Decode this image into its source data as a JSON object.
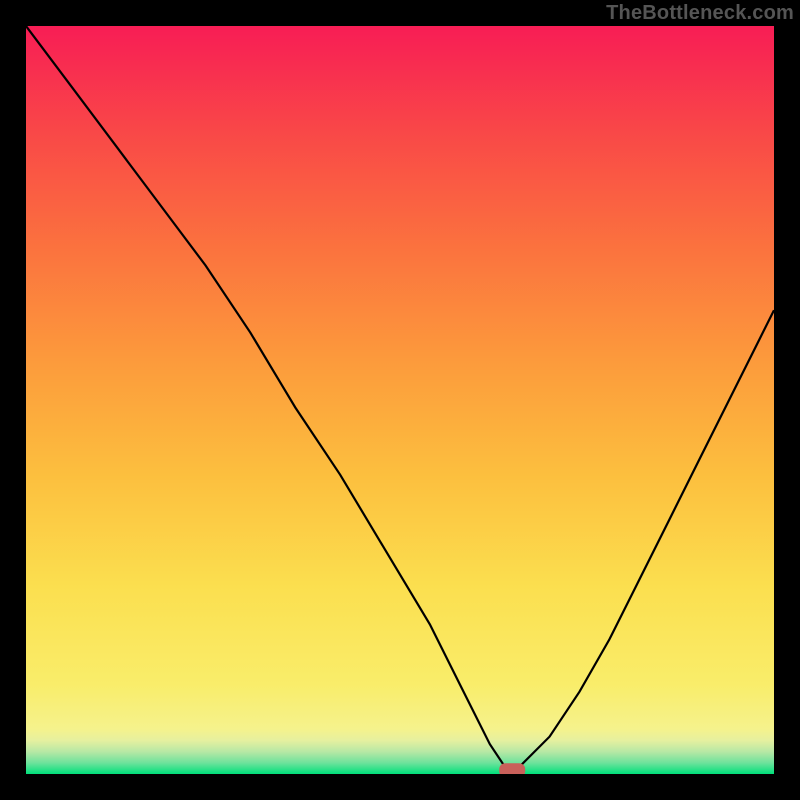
{
  "attribution": "TheBottleneck.com",
  "chart_data": {
    "type": "line",
    "title": "",
    "xlabel": "",
    "ylabel": "",
    "xlim": [
      0,
      100
    ],
    "ylim": [
      0,
      100
    ],
    "grid": false,
    "legend": false,
    "background": {
      "type": "vertical-gradient",
      "description": "Green at bottom through yellow/orange to red/magenta at top",
      "stops": [
        {
          "pos": 0.0,
          "color": "#00e07a"
        },
        {
          "pos": 0.015,
          "color": "#6ee29c"
        },
        {
          "pos": 0.03,
          "color": "#b8e8a5"
        },
        {
          "pos": 0.045,
          "color": "#e6f09f"
        },
        {
          "pos": 0.06,
          "color": "#f5f28c"
        },
        {
          "pos": 0.12,
          "color": "#f9ed6a"
        },
        {
          "pos": 0.25,
          "color": "#fbdf4f"
        },
        {
          "pos": 0.4,
          "color": "#fcbf3e"
        },
        {
          "pos": 0.55,
          "color": "#fc9b3c"
        },
        {
          "pos": 0.7,
          "color": "#fb733e"
        },
        {
          "pos": 0.85,
          "color": "#f94a47"
        },
        {
          "pos": 1.0,
          "color": "#f81d55"
        }
      ]
    },
    "series": [
      {
        "name": "bottleneck-curve",
        "color": "#000000",
        "x": [
          0,
          6,
          12,
          18,
          24,
          30,
          36,
          42,
          48,
          54,
          58,
          62,
          64,
          66,
          70,
          74,
          78,
          82,
          86,
          90,
          94,
          98,
          100
        ],
        "y": [
          100,
          92,
          84,
          76,
          68,
          59,
          49,
          40,
          30,
          20,
          12,
          4,
          1,
          1,
          5,
          11,
          18,
          26,
          34,
          42,
          50,
          58,
          62
        ]
      }
    ],
    "marker": {
      "name": "optimal-point",
      "shape": "rounded-rect",
      "x": 65,
      "y": 0.5,
      "color": "#c9605a"
    }
  }
}
